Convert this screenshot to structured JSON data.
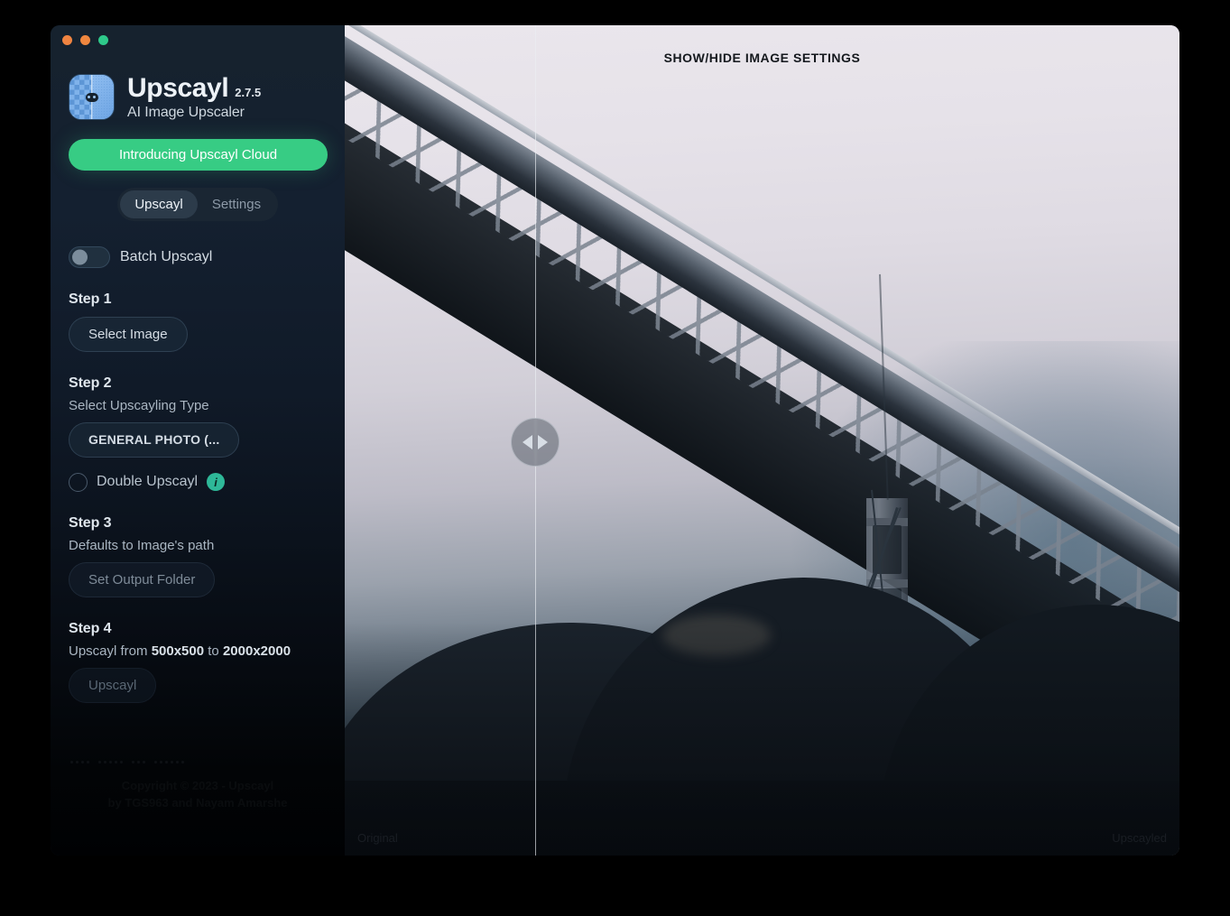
{
  "window": {
    "traffic_lights": [
      "close",
      "minimize",
      "maximize"
    ]
  },
  "brand": {
    "name": "Upscayl",
    "version": "2.7.5",
    "tagline": "AI Image Upscaler",
    "logo_icon": "upscayl-logo-icon"
  },
  "cloud_banner": {
    "label": "Introducing Upscayl Cloud",
    "color": "#37cc84"
  },
  "tabs": [
    {
      "label": "Upscayl",
      "active": true
    },
    {
      "label": "Settings",
      "active": false
    }
  ],
  "batch": {
    "label": "Batch Upscayl",
    "enabled": false
  },
  "steps": [
    {
      "title": "Step 1",
      "description": "",
      "button": "Select Image"
    },
    {
      "title": "Step 2",
      "description": "Select Upscayling Type",
      "button": "GENERAL PHOTO (..."
    },
    {
      "title": "Step 3",
      "description": "Defaults to Image's path",
      "button": "Set Output Folder"
    },
    {
      "title": "Step 4",
      "description_prefix": "Upscayl from ",
      "description_from": "500x500",
      "description_middle": " to ",
      "description_to": "2000x2000",
      "button": "Upscayl"
    }
  ],
  "double_upscayl": {
    "label": "Double Upscayl",
    "checked": false,
    "info_badge": "i"
  },
  "footer": {
    "line1": "Copyright © 2023 - Upscayl",
    "line2": "by TGS963 and Nayam Amarshe"
  },
  "image_pane": {
    "settings_toggle": "SHOW/HIDE IMAGE SETTINGS",
    "label_left": "Original",
    "label_right": "Upscayled",
    "divider_position_percent": 22.8,
    "handle_icon": "left-right-arrows-icon"
  }
}
